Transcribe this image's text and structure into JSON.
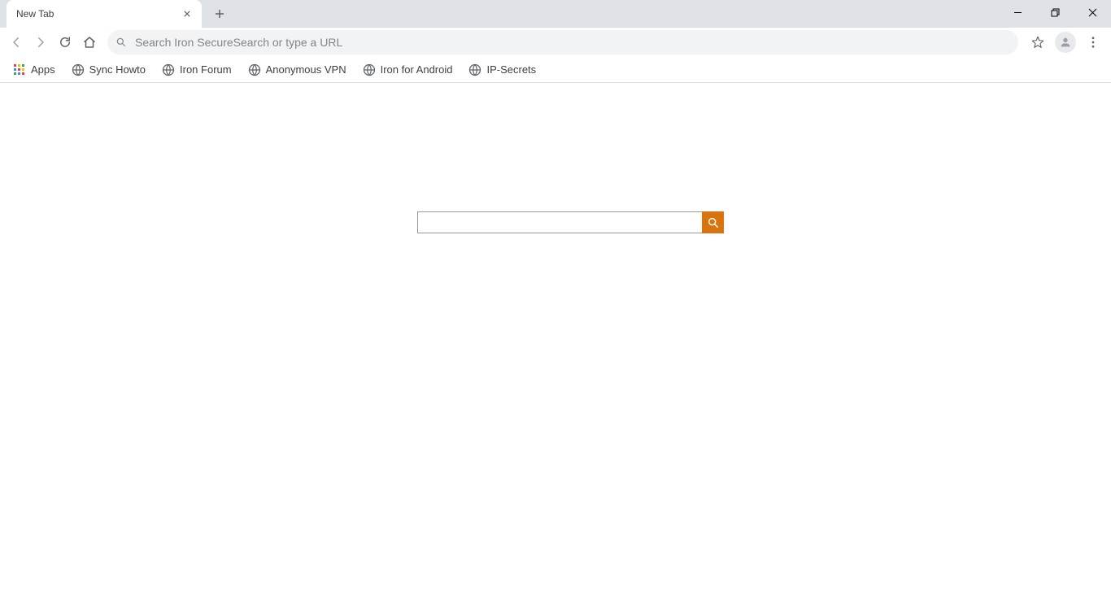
{
  "tab": {
    "title": "New Tab"
  },
  "omnibox": {
    "placeholder": "Search Iron SecureSearch or type a URL"
  },
  "bookmarks": {
    "apps_label": "Apps",
    "items": [
      {
        "label": "Sync Howto"
      },
      {
        "label": "Iron Forum"
      },
      {
        "label": "Anonymous VPN"
      },
      {
        "label": "Iron for Android"
      },
      {
        "label": "IP-Secrets"
      }
    ]
  },
  "page_search": {
    "value": "",
    "button_color": "#d9730d"
  }
}
